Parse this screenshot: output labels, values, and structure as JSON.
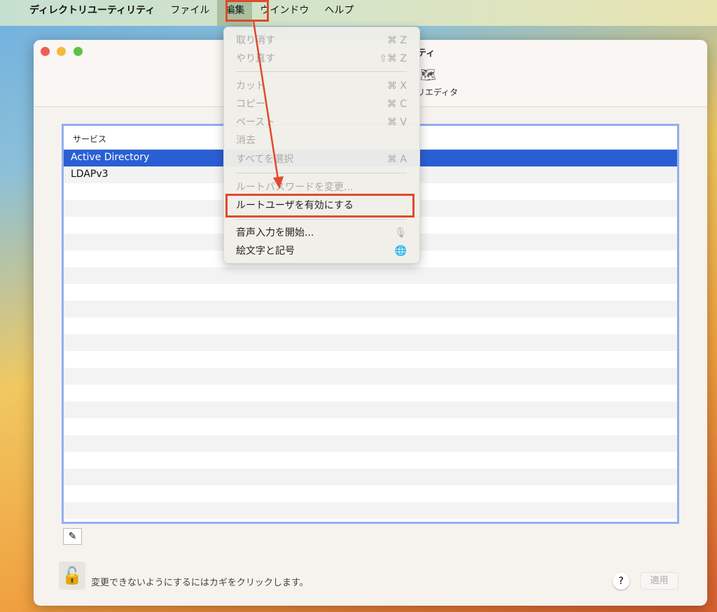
{
  "menubar": {
    "apple_icon": "apple-logo",
    "app": "ディレクトリユーティリティ",
    "items": [
      "ファイル",
      "編集",
      "ウインドウ",
      "ヘルプ"
    ]
  },
  "window": {
    "title_partial": "ティ",
    "toolbar_label_partial": "リエディタ",
    "toolbar_icon": "map-icon"
  },
  "table": {
    "header": "サービス",
    "rows": [
      "Active Directory",
      "LDAPv3"
    ],
    "selected": "Active Directory"
  },
  "footer": {
    "lock_text": "変更できないようにするにはカギをクリックします。",
    "help": "?",
    "apply": "適用"
  },
  "edit_menu": {
    "items": [
      {
        "label": "取り消す",
        "shortcut": "⌘ Z",
        "enabled": false
      },
      {
        "label": "やり直す",
        "shortcut": "⇧⌘ Z",
        "enabled": false
      },
      {
        "label": "カット",
        "shortcut": "⌘ X",
        "enabled": false
      },
      {
        "label": "コピー",
        "shortcut": "⌘ C",
        "enabled": false
      },
      {
        "label": "ペースト",
        "shortcut": "⌘ V",
        "enabled": false
      },
      {
        "label": "消去",
        "shortcut": "",
        "enabled": false
      },
      {
        "label": "すべてを選択",
        "shortcut": "⌘ A",
        "enabled": false
      },
      {
        "label": "ルートパスワードを変更...",
        "shortcut": "",
        "enabled": false
      },
      {
        "label": "ルートユーザを有効にする",
        "shortcut": "",
        "enabled": true
      },
      {
        "label": "音声入力を開始...",
        "shortcut": "🎙",
        "enabled": true
      },
      {
        "label": "絵文字と記号",
        "shortcut": "🌐",
        "enabled": true
      }
    ]
  },
  "annotation_color": "#e04a2c",
  "selection_color": "#2a5fd4"
}
